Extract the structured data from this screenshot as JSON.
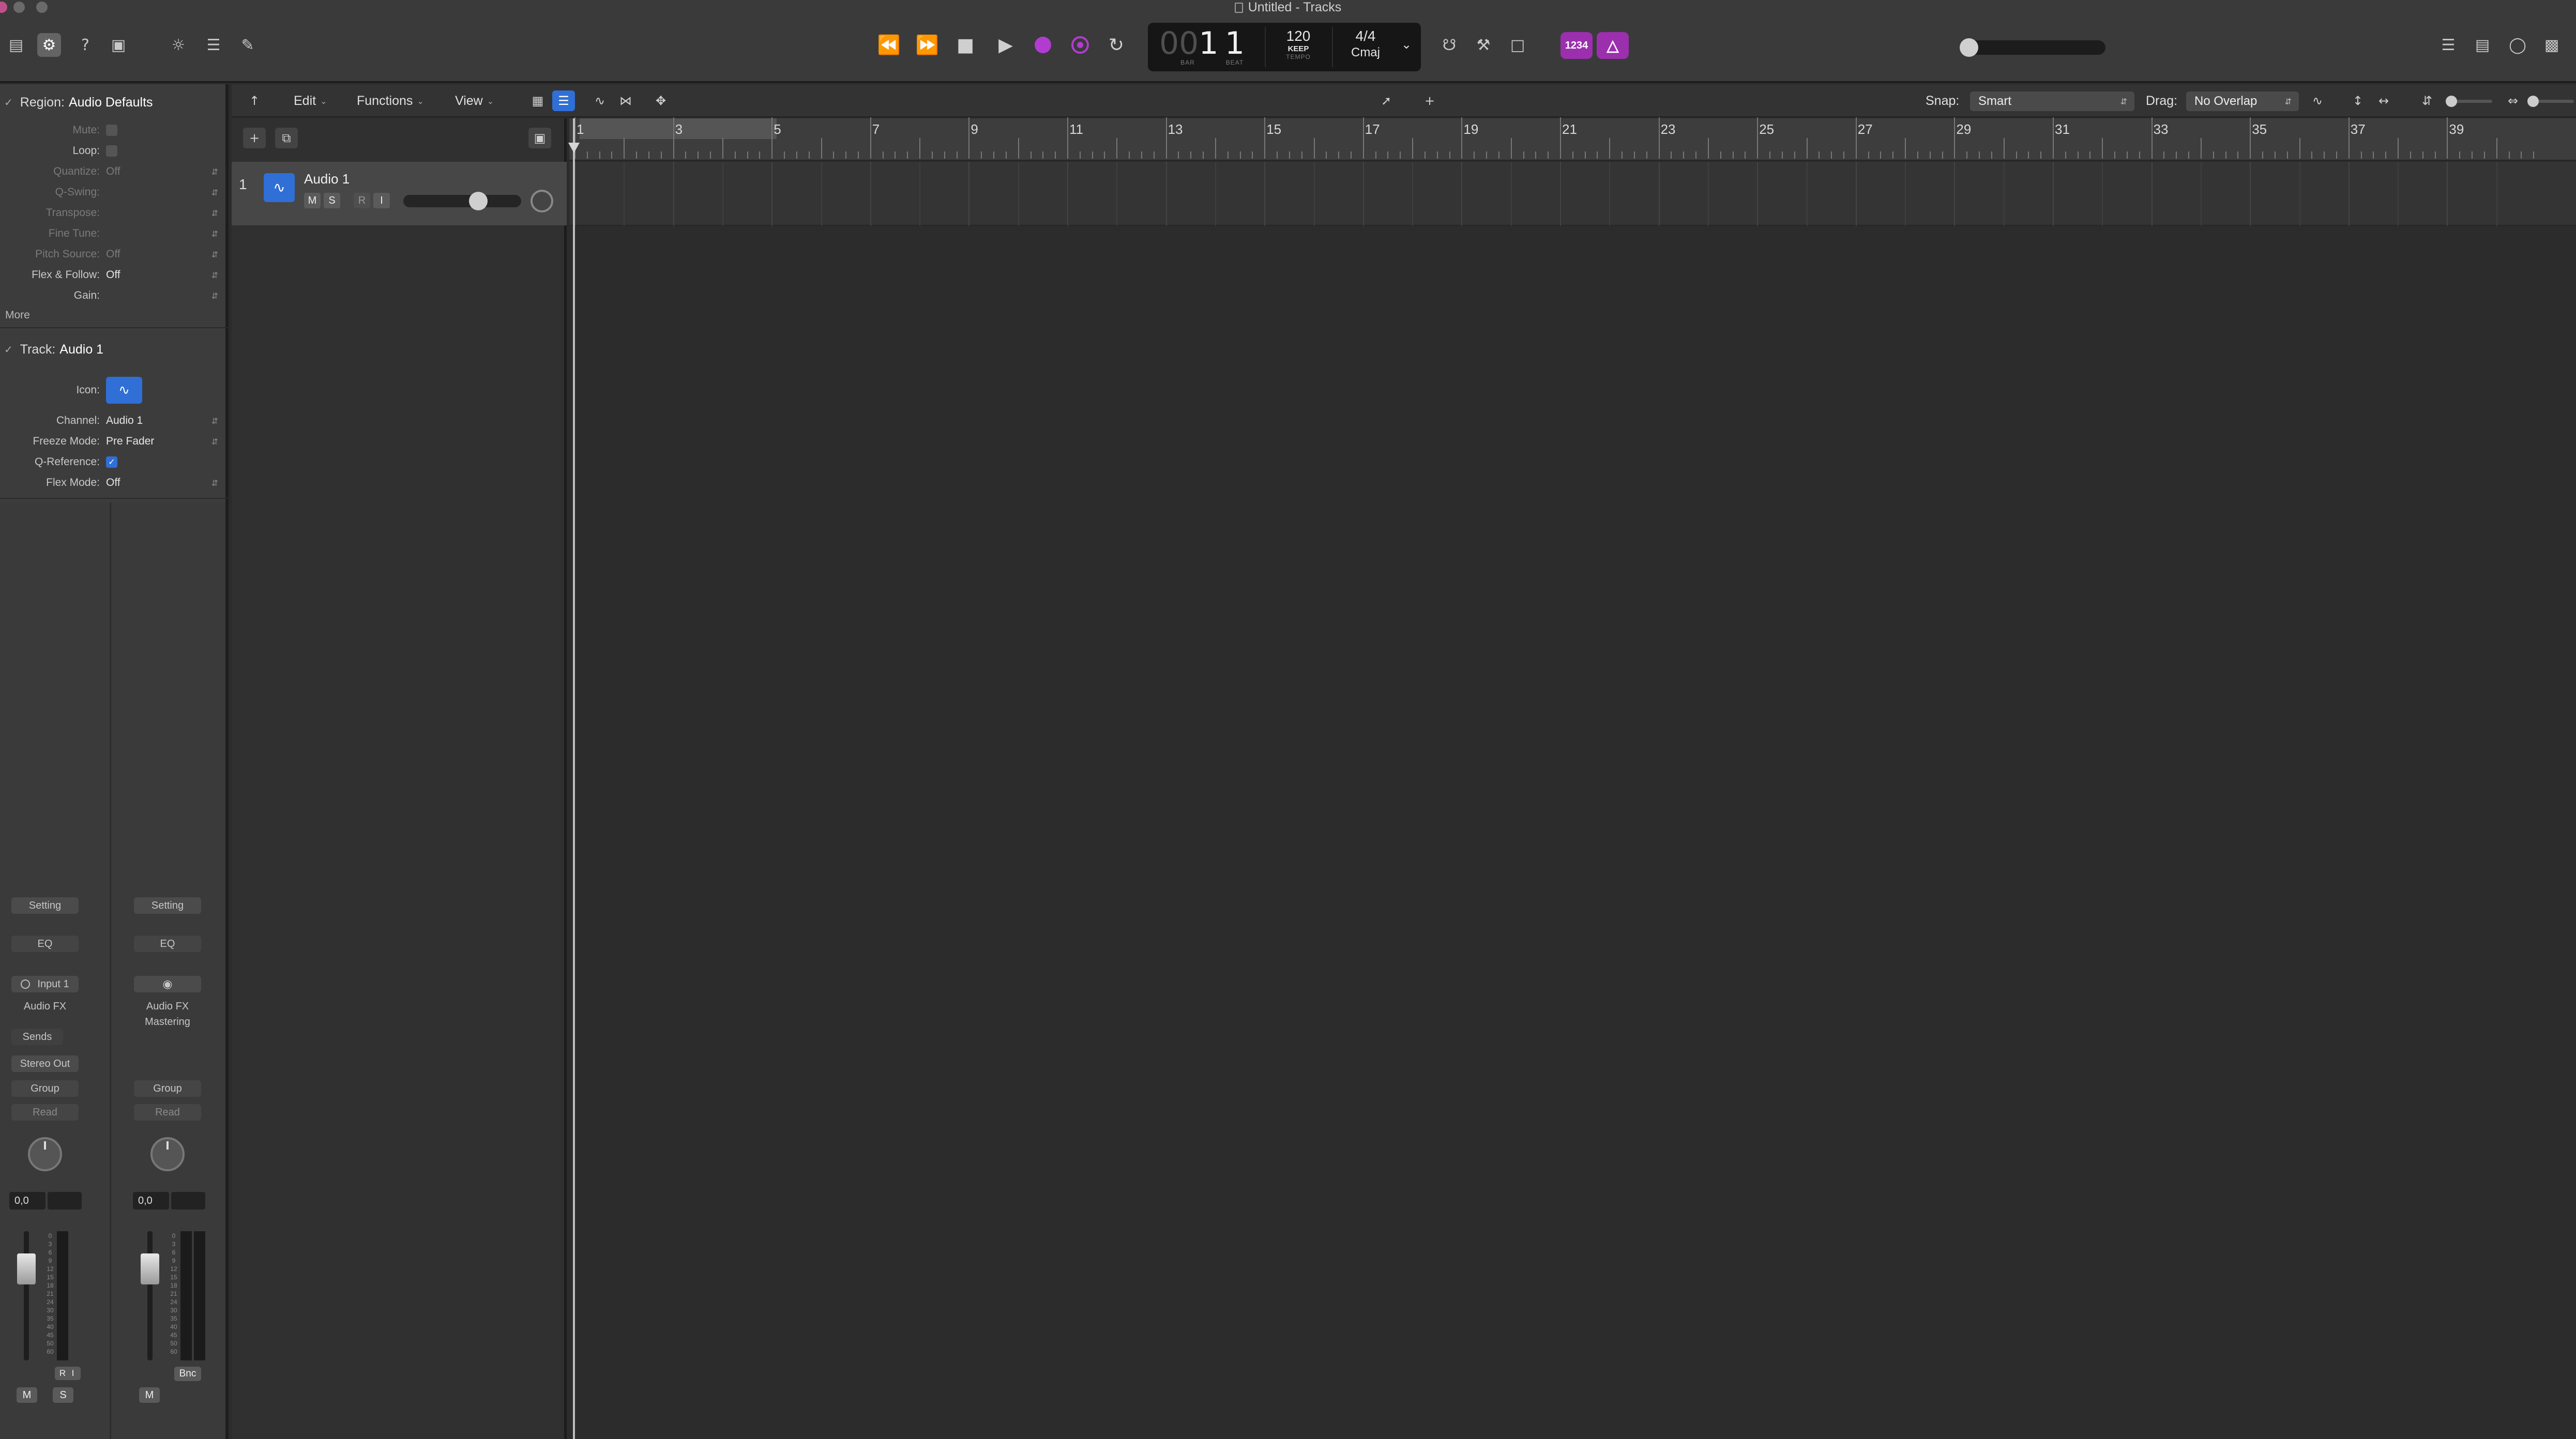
{
  "window": {
    "title": "Untitled - Tracks"
  },
  "transport": {
    "lcd": {
      "bar_dim": "00",
      "bar": "1",
      "beat": "1",
      "bar_caption": "BAR",
      "beat_caption": "BEAT",
      "tempo": "120",
      "tempo_mode": "KEEP",
      "tempo_caption": "TEMPO",
      "signature": "4/4",
      "key": "Cmaj"
    },
    "count_in_label": "1234",
    "metronome_label": "△"
  },
  "inspector": {
    "region": {
      "label": "Region:",
      "name": "Audio Defaults",
      "rows": [
        {
          "key": "Mute:",
          "value": "",
          "type": "checkbox",
          "dim": true
        },
        {
          "key": "Loop:",
          "value": "",
          "type": "checkbox",
          "dim": false
        },
        {
          "key": "Quantize:",
          "value": "Off",
          "dim": true
        },
        {
          "key": "Q-Swing:",
          "value": "",
          "dim": true
        },
        {
          "key": "Transpose:",
          "value": "",
          "dim": true
        },
        {
          "key": "Fine Tune:",
          "value": "",
          "dim": true
        },
        {
          "key": "Pitch Source:",
          "value": "Off",
          "dim": true
        },
        {
          "key": "Flex & Follow:",
          "value": "Off",
          "dim": false
        },
        {
          "key": "Gain:",
          "value": "",
          "dim": false
        }
      ],
      "more": "More"
    },
    "track": {
      "label": "Track:",
      "name": "Audio 1",
      "icon_label": "Icon:",
      "channel_label": "Channel:",
      "channel": "Audio 1",
      "freeze_label": "Freeze Mode:",
      "freeze": "Pre Fader",
      "qref_label": "Q-Reference:",
      "qref_check": "✓",
      "flex_label": "Flex Mode:",
      "flex": "Off"
    }
  },
  "strips": [
    {
      "setting": "Setting",
      "eq": "EQ",
      "input": "Input 1",
      "fx": "Audio FX",
      "fx2": "",
      "sends": "Sends",
      "output": "Stereo Out",
      "group": "Group",
      "automation": "Read",
      "value": "0,0",
      "fader_level": 0.71,
      "m": "M",
      "s": "S",
      "r": "R",
      "i": "I"
    },
    {
      "setting": "Setting",
      "eq": "EQ",
      "input": "",
      "fx": "Audio FX",
      "fx2": "Mastering",
      "sends": "",
      "output": "",
      "group": "Group",
      "automation": "Read",
      "value": "0,0",
      "fader_level": 0.71,
      "m": "M",
      "bnc": "Bnc"
    }
  ],
  "meter_scale": [
    "0",
    "3",
    "6",
    "9",
    "12",
    "15",
    "18",
    "21",
    "24",
    "30",
    "35",
    "40",
    "45",
    "50",
    "60"
  ],
  "tracks_toolbar": {
    "edit": "Edit",
    "functions": "Functions",
    "view": "View",
    "snap_label": "Snap:",
    "snap_value": "Smart",
    "drag_label": "Drag:",
    "drag_value": "No Overlap"
  },
  "track": {
    "number": "1",
    "name": "Audio 1",
    "mute": "M",
    "solo": "S",
    "record": "R",
    "input": "I",
    "volume_level": 0.66
  },
  "ruler": {
    "bars": [
      "1",
      "3",
      "5",
      "7",
      "9",
      "11",
      "13",
      "15",
      "17",
      "19",
      "21",
      "23",
      "25",
      "27",
      "29",
      "31",
      "33",
      "35",
      "37",
      "39"
    ]
  }
}
